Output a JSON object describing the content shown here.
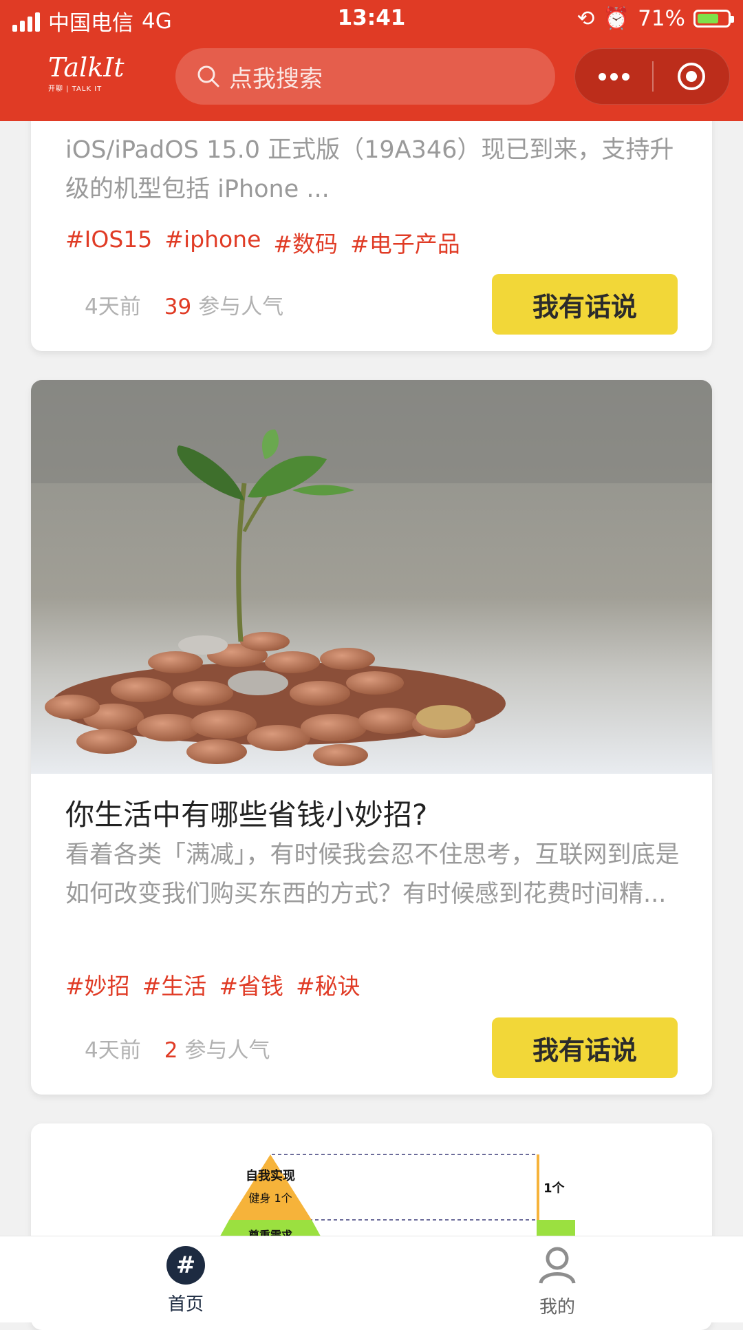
{
  "status": {
    "carrier": "中国电信",
    "network": "4G",
    "time": "13:41",
    "battery_percent": "71%",
    "battery_level": 0.71
  },
  "header": {
    "logo_text": "TalkIt",
    "logo_sub": "开聊 | TALK IT",
    "search_placeholder": "点我搜索"
  },
  "cards": [
    {
      "desc": "iOS/iPadOS 15.0 正式版（19A346）现已到来，支持升级的机型包括 iPhone ...",
      "tags": [
        "#IOS15",
        "#iphone",
        "#数码",
        "#电子产品"
      ],
      "time": "4天前",
      "count": "39",
      "count_label": "参与人气",
      "button": "我有话说"
    },
    {
      "title": "你生活中有哪些省钱小妙招?",
      "desc": "看着各类「满减」，有时候我会忍不住思考，互联网到底是如何改变我们购买东西的方式？有时候感到花费时间精...",
      "tags": [
        "#妙招",
        "#生活",
        "#省钱",
        "#秘诀"
      ],
      "time": "4天前",
      "count": "2",
      "count_label": "参与人气",
      "button": "我有话说"
    },
    {
      "pyramid_top_title": "自我实现",
      "pyramid_top_sub": "健身 1个",
      "pyramid_next": "尊重需求",
      "bar_label": "1个"
    }
  ],
  "tabbar": {
    "home": "首页",
    "mine": "我的"
  },
  "colors": {
    "brand_red": "#e03b25",
    "button_yellow": "#f2d738",
    "tag_red": "#e03b25"
  }
}
